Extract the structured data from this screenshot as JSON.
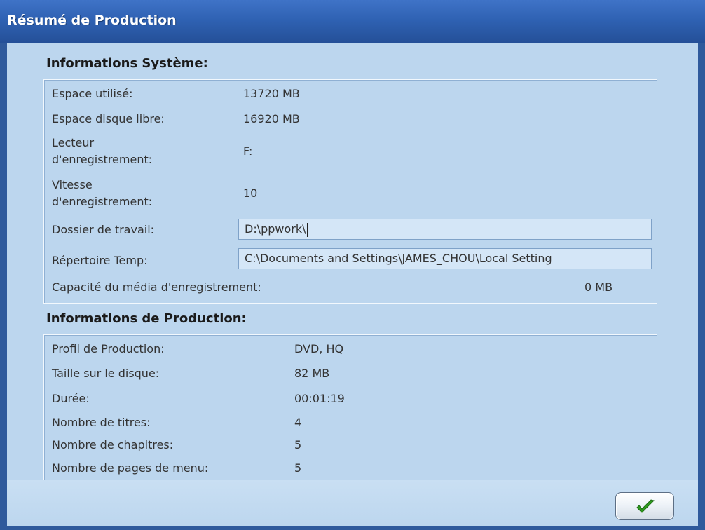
{
  "window": {
    "title": "Résumé de Production"
  },
  "system": {
    "heading": "Informations Système:",
    "used_space_label": "Espace utilisé:",
    "used_space_value": "13720 MB",
    "free_space_label": "Espace disque libre:",
    "free_space_value": "16920 MB",
    "drive_label_1": "Lecteur",
    "drive_label_2": "d'enregistrement:",
    "drive_value": "F:",
    "speed_label_1": "Vitesse",
    "speed_label_2": "d'enregistrement:",
    "speed_value": "10",
    "work_folder_label": "Dossier de travail:",
    "work_folder_value": "D:\\ppwork\\",
    "temp_dir_label": "Répertoire Temp:",
    "temp_dir_value": "C:\\Documents and Settings\\JAMES_CHOU\\Local Setting",
    "media_capacity_label": "Capacité du média d'enregistrement:",
    "media_capacity_value": "0 MB"
  },
  "production": {
    "heading": "Informations de Production:",
    "rows": [
      {
        "label": "Profil de Production:",
        "value": "DVD, HQ"
      },
      {
        "label": "Taille sur le disque:",
        "value": "82 MB"
      },
      {
        "label": "Durée:",
        "value": "00:01:19"
      },
      {
        "label": "Nombre de titres:",
        "value": "4"
      },
      {
        "label": "Nombre de chapitres:",
        "value": "5"
      },
      {
        "label": "Nombre de pages de menu:",
        "value": "5"
      }
    ]
  },
  "icons": {
    "ok": "check-icon"
  },
  "colors": {
    "titlebar": "#2f62b3",
    "panel": "#bcd6ee",
    "check": "#2e9a1e"
  }
}
